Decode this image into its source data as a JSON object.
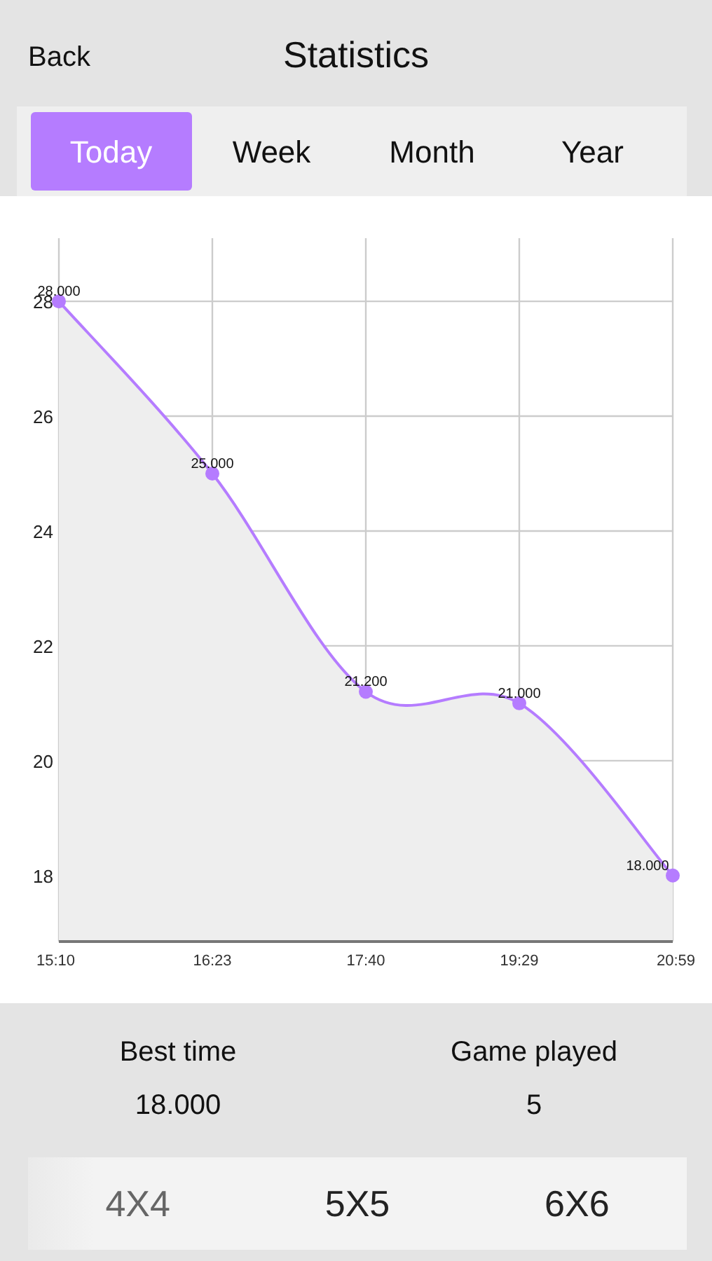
{
  "header": {
    "back": "Back",
    "title": "Statistics"
  },
  "tabs": [
    {
      "label": "Today",
      "selected": true
    },
    {
      "label": "Week",
      "selected": false
    },
    {
      "label": "Month",
      "selected": false
    },
    {
      "label": "Year",
      "selected": false
    }
  ],
  "chart": {
    "chart_data": {
      "type": "area",
      "grid": true,
      "categories": [
        "15:10",
        "16:23",
        "17:40",
        "19:29",
        "20:59"
      ],
      "series": [
        {
          "color": "#b57cff",
          "marker": true,
          "values": [
            28,
            25,
            21.2,
            21,
            18
          ]
        }
      ],
      "ylim": [
        16.85,
        29.1
      ],
      "yticks": [
        18,
        20,
        22,
        24,
        26,
        28
      ],
      "value_labels": [
        "28.000",
        "25.000",
        "21.200",
        "21.000",
        "18.000"
      ]
    }
  },
  "stats": [
    {
      "label": "Best time",
      "value": "18.000"
    },
    {
      "label": "Game played",
      "value": "5"
    }
  ],
  "sizes": [
    {
      "label": "4X4",
      "selected": true
    },
    {
      "label": "5X5",
      "selected": false
    },
    {
      "label": "6X6",
      "selected": false
    }
  ]
}
